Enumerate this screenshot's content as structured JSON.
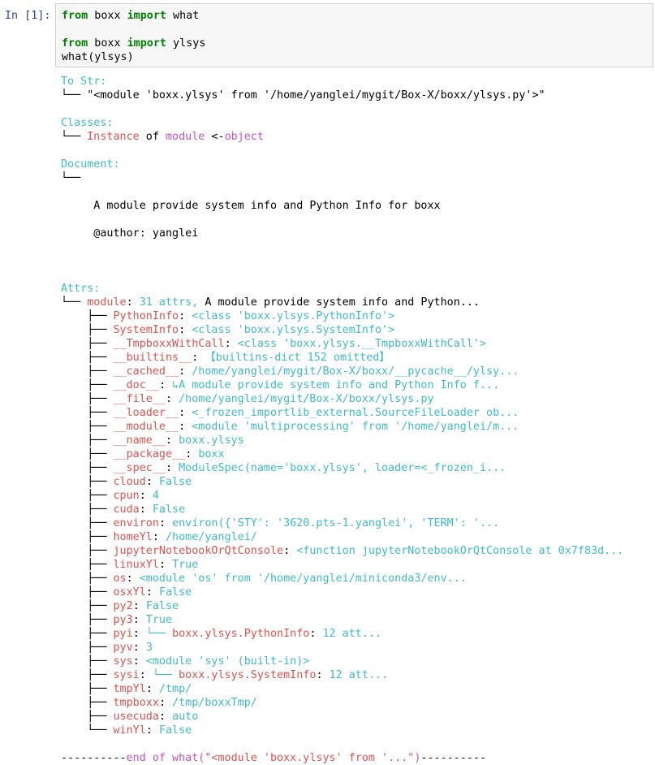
{
  "cell": {
    "prompt": "In [1]:",
    "code_lines": [
      [
        {
          "t": "from",
          "c": "kw"
        },
        {
          "t": " boxx ",
          "c": ""
        },
        {
          "t": "import",
          "c": "kw"
        },
        {
          "t": " what",
          "c": ""
        }
      ],
      [],
      [
        {
          "t": "from",
          "c": "kw"
        },
        {
          "t": " boxx ",
          "c": ""
        },
        {
          "t": "import",
          "c": "kw"
        },
        {
          "t": " ylsys",
          "c": ""
        }
      ],
      [
        {
          "t": "what(ylsys)",
          "c": ""
        }
      ]
    ]
  },
  "colors": {
    "cyan": "#3fb9c8",
    "red": "#d9534f",
    "magenta": "#c452c4",
    "keyword": "#008000",
    "prompt": "#303f9f"
  },
  "output_lines": [
    [
      {
        "t": "To Str:",
        "c": "cyan"
      }
    ],
    [
      {
        "t": "└── \"<module 'boxx.ylsys' from '/home/yanglei/mygit/Box-X/boxx/ylsys.py'>\"",
        "c": ""
      }
    ],
    [],
    [
      {
        "t": "Classes:",
        "c": "cyan"
      }
    ],
    [
      {
        "t": "└── ",
        "c": ""
      },
      {
        "t": "Instance",
        "c": "red"
      },
      {
        "t": " of ",
        "c": ""
      },
      {
        "t": "module",
        "c": "magenta"
      },
      {
        "t": " <-",
        "c": ""
      },
      {
        "t": "object",
        "c": "magenta"
      }
    ],
    [],
    [
      {
        "t": "Document:",
        "c": "cyan"
      }
    ],
    [
      {
        "t": "└──",
        "c": ""
      }
    ],
    [],
    [
      {
        "t": "     A module provide system info and Python Info for boxx",
        "c": ""
      }
    ],
    [],
    [
      {
        "t": "     @author: yanglei",
        "c": ""
      }
    ],
    [],
    [],
    [],
    [
      {
        "t": "Attrs:",
        "c": "cyan"
      }
    ],
    [
      {
        "t": "└── ",
        "c": ""
      },
      {
        "t": "module",
        "c": "red"
      },
      {
        "t": ": ",
        "c": ""
      },
      {
        "t": "31 attrs,",
        "c": "cyan"
      },
      {
        "t": " A module provide system info and Python...",
        "c": ""
      }
    ],
    [
      {
        "t": "    ├── ",
        "c": ""
      },
      {
        "t": "PythonInfo",
        "c": "red"
      },
      {
        "t": ": ",
        "c": ""
      },
      {
        "t": "<class 'boxx.ylsys.PythonInfo'>",
        "c": "cyan"
      }
    ],
    [
      {
        "t": "    ├── ",
        "c": ""
      },
      {
        "t": "SystemInfo",
        "c": "red"
      },
      {
        "t": ": ",
        "c": ""
      },
      {
        "t": "<class 'boxx.ylsys.SystemInfo'>",
        "c": "cyan"
      }
    ],
    [
      {
        "t": "    ├── ",
        "c": ""
      },
      {
        "t": "__TmpboxxWithCall",
        "c": "red"
      },
      {
        "t": ": ",
        "c": ""
      },
      {
        "t": "<class 'boxx.ylsys.__TmpboxxWithCall'>",
        "c": "cyan"
      }
    ],
    [
      {
        "t": "    ├── ",
        "c": ""
      },
      {
        "t": "__builtins__",
        "c": "red"
      },
      {
        "t": ": ",
        "c": ""
      },
      {
        "t": "【builtins-dict 152 omitted】",
        "c": "cyan"
      }
    ],
    [
      {
        "t": "    ├── ",
        "c": ""
      },
      {
        "t": "__cached__",
        "c": "red"
      },
      {
        "t": ": ",
        "c": ""
      },
      {
        "t": "/home/yanglei/mygit/Box-X/boxx/__pycache__/ylsy...",
        "c": "cyan"
      }
    ],
    [
      {
        "t": "    ├── ",
        "c": ""
      },
      {
        "t": "__doc__",
        "c": "red"
      },
      {
        "t": ": ",
        "c": ""
      },
      {
        "t": "↳A module provide system info and Python Info f...",
        "c": "cyan"
      }
    ],
    [
      {
        "t": "    ├── ",
        "c": ""
      },
      {
        "t": "__file__",
        "c": "red"
      },
      {
        "t": ": ",
        "c": ""
      },
      {
        "t": "/home/yanglei/mygit/Box-X/boxx/ylsys.py",
        "c": "cyan"
      }
    ],
    [
      {
        "t": "    ├── ",
        "c": ""
      },
      {
        "t": "__loader__",
        "c": "red"
      },
      {
        "t": ": ",
        "c": ""
      },
      {
        "t": "<_frozen_importlib_external.SourceFileLoader ob...",
        "c": "cyan"
      }
    ],
    [
      {
        "t": "    ├── ",
        "c": ""
      },
      {
        "t": "__module__",
        "c": "red"
      },
      {
        "t": ": ",
        "c": ""
      },
      {
        "t": "<module 'multiprocessing' from '/home/yanglei/m...",
        "c": "cyan"
      }
    ],
    [
      {
        "t": "    ├── ",
        "c": ""
      },
      {
        "t": "__name__",
        "c": "red"
      },
      {
        "t": ": ",
        "c": ""
      },
      {
        "t": "boxx.ylsys",
        "c": "cyan"
      }
    ],
    [
      {
        "t": "    ├── ",
        "c": ""
      },
      {
        "t": "__package__",
        "c": "red"
      },
      {
        "t": ": ",
        "c": ""
      },
      {
        "t": "boxx",
        "c": "cyan"
      }
    ],
    [
      {
        "t": "    ├── ",
        "c": ""
      },
      {
        "t": "__spec__",
        "c": "red"
      },
      {
        "t": ": ",
        "c": ""
      },
      {
        "t": "ModuleSpec(name='boxx.ylsys', loader=<_frozen_i...",
        "c": "cyan"
      }
    ],
    [
      {
        "t": "    ├── ",
        "c": ""
      },
      {
        "t": "cloud",
        "c": "red"
      },
      {
        "t": ": ",
        "c": ""
      },
      {
        "t": "False",
        "c": "cyan"
      }
    ],
    [
      {
        "t": "    ├── ",
        "c": ""
      },
      {
        "t": "cpun",
        "c": "red"
      },
      {
        "t": ": ",
        "c": ""
      },
      {
        "t": "4",
        "c": "cyan"
      }
    ],
    [
      {
        "t": "    ├── ",
        "c": ""
      },
      {
        "t": "cuda",
        "c": "red"
      },
      {
        "t": ": ",
        "c": ""
      },
      {
        "t": "False",
        "c": "cyan"
      }
    ],
    [
      {
        "t": "    ├── ",
        "c": ""
      },
      {
        "t": "environ",
        "c": "red"
      },
      {
        "t": ": ",
        "c": ""
      },
      {
        "t": "environ({'STY': '3620.pts-1.yanglei', 'TERM': '...",
        "c": "cyan"
      }
    ],
    [
      {
        "t": "    ├── ",
        "c": ""
      },
      {
        "t": "homeYl",
        "c": "red"
      },
      {
        "t": ": ",
        "c": ""
      },
      {
        "t": "/home/yanglei/",
        "c": "cyan"
      }
    ],
    [
      {
        "t": "    ├── ",
        "c": ""
      },
      {
        "t": "jupyterNotebookOrQtConsole",
        "c": "red"
      },
      {
        "t": ": ",
        "c": ""
      },
      {
        "t": "<function jupyterNotebookOrQtConsole at 0x7f83d...",
        "c": "cyan"
      }
    ],
    [
      {
        "t": "    ├── ",
        "c": ""
      },
      {
        "t": "linuxYl",
        "c": "red"
      },
      {
        "t": ": ",
        "c": ""
      },
      {
        "t": "True",
        "c": "cyan"
      }
    ],
    [
      {
        "t": "    ├── ",
        "c": ""
      },
      {
        "t": "os",
        "c": "red"
      },
      {
        "t": ": ",
        "c": ""
      },
      {
        "t": "<module 'os' from '/home/yanglei/miniconda3/env...",
        "c": "cyan"
      }
    ],
    [
      {
        "t": "    ├── ",
        "c": ""
      },
      {
        "t": "osxYl",
        "c": "red"
      },
      {
        "t": ": ",
        "c": ""
      },
      {
        "t": "False",
        "c": "cyan"
      }
    ],
    [
      {
        "t": "    ├── ",
        "c": ""
      },
      {
        "t": "py2",
        "c": "red"
      },
      {
        "t": ": ",
        "c": ""
      },
      {
        "t": "False",
        "c": "cyan"
      }
    ],
    [
      {
        "t": "    ├── ",
        "c": ""
      },
      {
        "t": "py3",
        "c": "red"
      },
      {
        "t": ": ",
        "c": ""
      },
      {
        "t": "True",
        "c": "cyan"
      }
    ],
    [
      {
        "t": "    ├── ",
        "c": ""
      },
      {
        "t": "pyi",
        "c": "red"
      },
      {
        "t": ": ",
        "c": ""
      },
      {
        "t": "└── ",
        "c": "cyan"
      },
      {
        "t": "boxx.ylsys.PythonInfo",
        "c": "red"
      },
      {
        "t": ": ",
        "c": ""
      },
      {
        "t": "12 att...",
        "c": "cyan"
      }
    ],
    [
      {
        "t": "    ├── ",
        "c": ""
      },
      {
        "t": "pyv",
        "c": "red"
      },
      {
        "t": ": ",
        "c": ""
      },
      {
        "t": "3",
        "c": "cyan"
      }
    ],
    [
      {
        "t": "    ├── ",
        "c": ""
      },
      {
        "t": "sys",
        "c": "red"
      },
      {
        "t": ": ",
        "c": ""
      },
      {
        "t": "<module 'sys' (built-in)>",
        "c": "cyan"
      }
    ],
    [
      {
        "t": "    ├── ",
        "c": ""
      },
      {
        "t": "sysi",
        "c": "red"
      },
      {
        "t": ": ",
        "c": ""
      },
      {
        "t": "└── ",
        "c": "cyan"
      },
      {
        "t": "boxx.ylsys.SystemInfo",
        "c": "red"
      },
      {
        "t": ": ",
        "c": ""
      },
      {
        "t": "12 att...",
        "c": "cyan"
      }
    ],
    [
      {
        "t": "    ├── ",
        "c": ""
      },
      {
        "t": "tmpYl",
        "c": "red"
      },
      {
        "t": ": ",
        "c": ""
      },
      {
        "t": "/tmp/",
        "c": "cyan"
      }
    ],
    [
      {
        "t": "    ├── ",
        "c": ""
      },
      {
        "t": "tmpboxx",
        "c": "red"
      },
      {
        "t": ": ",
        "c": ""
      },
      {
        "t": "/tmp/boxxTmp/",
        "c": "cyan"
      }
    ],
    [
      {
        "t": "    ├── ",
        "c": ""
      },
      {
        "t": "usecuda",
        "c": "red"
      },
      {
        "t": ": ",
        "c": ""
      },
      {
        "t": "auto",
        "c": "cyan"
      }
    ],
    [
      {
        "t": "    └── ",
        "c": ""
      },
      {
        "t": "winYl",
        "c": "red"
      },
      {
        "t": ": ",
        "c": ""
      },
      {
        "t": "False",
        "c": "cyan"
      }
    ],
    [],
    [
      {
        "t": "----------",
        "c": ""
      },
      {
        "t": "end of what(",
        "c": "magenta"
      },
      {
        "t": "\"<module 'boxx.ylsys' from '...\"",
        "c": "red"
      },
      {
        "t": ")",
        "c": "magenta"
      },
      {
        "t": "----------",
        "c": ""
      }
    ]
  ]
}
